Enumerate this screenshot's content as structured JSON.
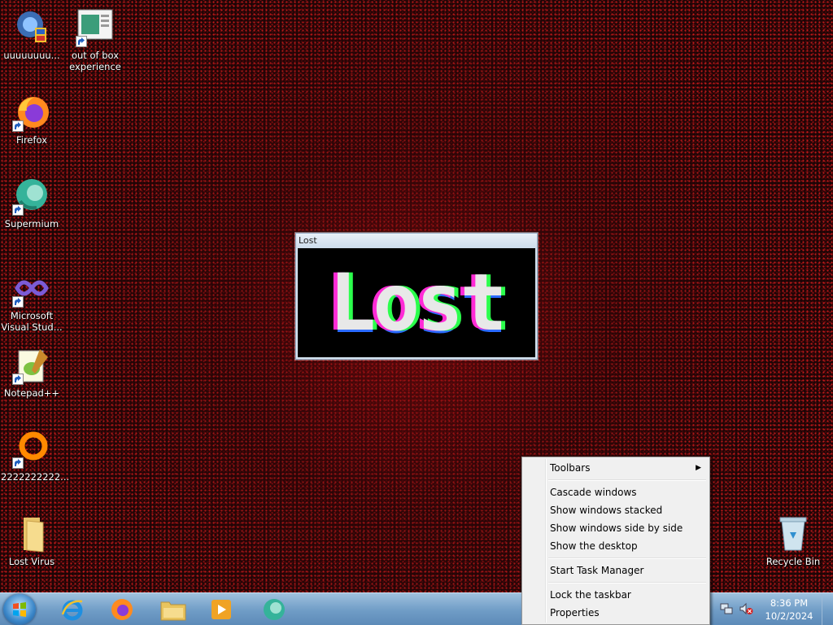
{
  "desktop": {
    "icons": [
      {
        "label": "uuuuuuuu..."
      },
      {
        "label": "out of box experience"
      },
      {
        "label": "Firefox"
      },
      {
        "label": "Supermium"
      },
      {
        "label": "Microsoft Visual Stud..."
      },
      {
        "label": "Notepad++"
      },
      {
        "label": "2222222222..."
      },
      {
        "label": "Lost Virus"
      },
      {
        "label": "Recycle Bin"
      }
    ]
  },
  "lost_window": {
    "title": "Lost",
    "logo_text": "Lost"
  },
  "context_menu": {
    "items": [
      {
        "label": "Toolbars",
        "submenu": true
      },
      {
        "label": "Cascade windows"
      },
      {
        "label": "Show windows stacked"
      },
      {
        "label": "Show windows side by side"
      },
      {
        "label": "Show the desktop"
      },
      {
        "label": "Start Task Manager"
      },
      {
        "label": "Lock the taskbar"
      },
      {
        "label": "Properties"
      }
    ]
  },
  "taskbar": {
    "pinned": [
      "internet-explorer-icon",
      "firefox-icon",
      "file-explorer-icon",
      "media-player-icon",
      "supermium-icon"
    ],
    "clock": {
      "time": "8:36 PM",
      "date": "10/2/2024"
    }
  }
}
